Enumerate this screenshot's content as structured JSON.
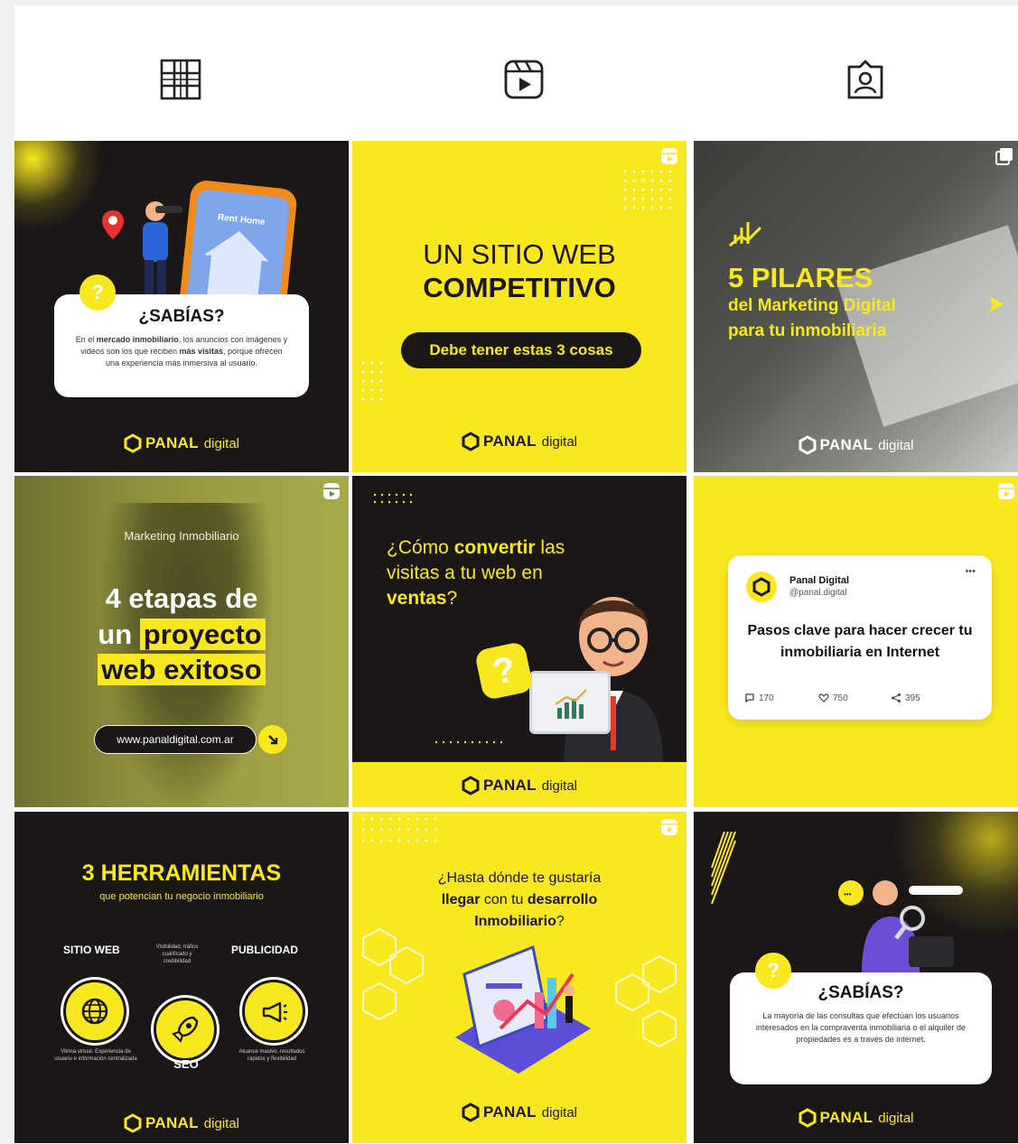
{
  "tabs": [
    {
      "name": "grid-icon"
    },
    {
      "name": "reels-icon"
    },
    {
      "name": "tagged-icon"
    }
  ],
  "brand": {
    "name": "PANAL",
    "suffix": "digital",
    "yellow": "#f8e81f",
    "dark": "#1b1717"
  },
  "posts": {
    "p1": {
      "title": "¿SABÍAS?",
      "body_a": "En el ",
      "body_b": "mercado inmobiliario",
      "body_c": ", los anuncios con imágenes y videos son los que reciben ",
      "body_d": "más visitas",
      "body_e": ", porque ofrecen una experiencia más inmersiva al usuario.",
      "phone_label": "Rent Home"
    },
    "p2": {
      "line1": "UN SITIO WEB",
      "line2": "COMPETITIVO",
      "pill": "Debe tener estas 3 cosas"
    },
    "p3": {
      "number": "5 PILARES",
      "line1": "del Marketing Digital",
      "line2": "para tu inmobiliaria"
    },
    "p4": {
      "kicker": "Marketing Inmobiliario",
      "line1": "4 etapas de",
      "line2a": "un ",
      "line2b": "proyecto",
      "line3": "web exitoso",
      "url": "www.panaldigital.com.ar"
    },
    "p5": {
      "q1": "¿Cómo ",
      "q2": "convertir",
      "q3": " las",
      "q4": "visitas a tu web en",
      "q5": "ventas",
      "q6": "?"
    },
    "p6": {
      "account_name": "Panal Digital",
      "account_handle": "@panal.digital",
      "text": "Pasos clave para hacer crecer tu inmobiliaria en Internet",
      "comments": "170",
      "likes": "750",
      "shares": "395",
      "more": "•••"
    },
    "p7": {
      "title": "3 HERRAMIENTAS",
      "subtitle": "que potencian tu negocio inmobiliario",
      "left_label": "SITIO WEB",
      "left_desc": "Vitrina virtual. Experiencia de usuario e información centralizada",
      "mid_desc": "Visibilidad, tráfico cualificado y credibilidad",
      "mid_label": "SEO",
      "right_label": "PUBLICIDAD",
      "right_desc": "Alcance masivo, resultados rápidos y flexibilidad"
    },
    "p8": {
      "l1": "¿Hasta dónde te gustaría",
      "l2a": "llegar",
      "l2b": " con tu ",
      "l2c": "desarrollo",
      "l3a": "Inmobiliario",
      "l3b": "?"
    },
    "p9": {
      "title": "¿SABÍAS?",
      "body": "La mayoría de las consultas que efectúan los usuarios interesados en la compraventa inmobiliaria o el alquiler de propiedades es a través de internet."
    }
  }
}
